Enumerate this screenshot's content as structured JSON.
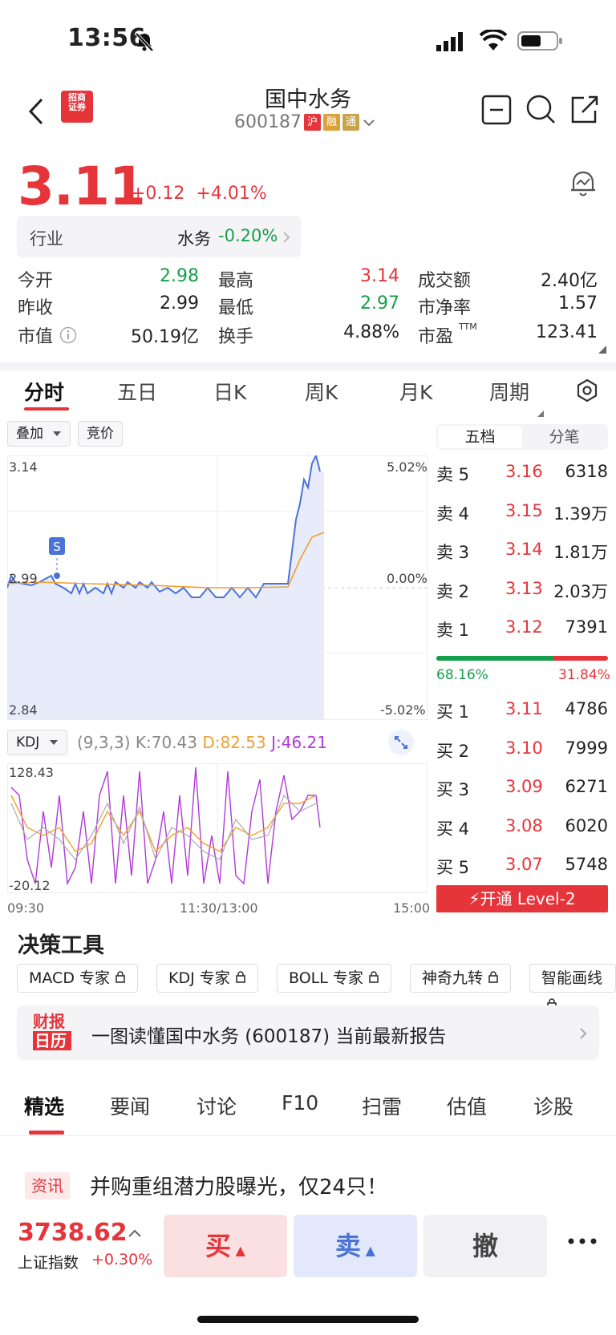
{
  "status": {
    "time": "13:56"
  },
  "header": {
    "title": "国中水务",
    "code": "600187",
    "badges": [
      "沪",
      "融",
      "通"
    ]
  },
  "quote": {
    "price": "3.11",
    "change": "+0.12",
    "change_pct": "+4.01%"
  },
  "industry": {
    "label": "行业",
    "name": "水务",
    "change": "-0.20%"
  },
  "stats": [
    {
      "label": "今开",
      "value": "2.98",
      "color": "green"
    },
    {
      "label": "最高",
      "value": "3.14",
      "color": "red"
    },
    {
      "label": "成交额",
      "value": "2.40亿",
      "color": ""
    },
    {
      "label": "昨收",
      "value": "2.99",
      "color": ""
    },
    {
      "label": "最低",
      "value": "2.97",
      "color": "green"
    },
    {
      "label": "市净率",
      "value": "1.57",
      "color": ""
    },
    {
      "label": "市值",
      "value": "50.19亿",
      "color": ""
    },
    {
      "label": "换手",
      "value": "4.88%",
      "color": ""
    },
    {
      "label": "市盈",
      "value": "123.41",
      "color": ""
    }
  ],
  "ttm": "TTM",
  "tabs": [
    "分时",
    "五日",
    "日K",
    "周K",
    "月K",
    "周期"
  ],
  "chips": {
    "overlay": "叠加",
    "auction": "竞价"
  },
  "chart": {
    "y_top": "3.14",
    "y_mid": "2.99",
    "y_bot": "2.84",
    "pct_top": "5.02%",
    "pct_mid": "0.00%",
    "pct_bot": "-5.02%",
    "marker": "S",
    "times": [
      "09:30",
      "11:30/13:00",
      "15:00"
    ]
  },
  "kdj": {
    "label": "KDJ",
    "params": "(9,3,3)",
    "k": "K:70.43",
    "d": "D:82.53",
    "j": "J:46.21",
    "top": "128.43",
    "bot": "-20.12"
  },
  "orderbook": {
    "tabs": [
      "五档",
      "分笔"
    ],
    "asks": [
      {
        "label": "卖 5",
        "price": "3.16",
        "vol": "6318"
      },
      {
        "label": "卖 4",
        "price": "3.15",
        "vol": "1.39万"
      },
      {
        "label": "卖 3",
        "price": "3.14",
        "vol": "1.81万"
      },
      {
        "label": "卖 2",
        "price": "3.13",
        "vol": "2.03万"
      },
      {
        "label": "卖 1",
        "price": "3.12",
        "vol": "7391"
      }
    ],
    "ratio_buy": "68.16%",
    "ratio_sell": "31.84%",
    "ratio_buy_value": 68.16,
    "bids": [
      {
        "label": "买 1",
        "price": "3.11",
        "vol": "4786"
      },
      {
        "label": "买 2",
        "price": "3.10",
        "vol": "7999"
      },
      {
        "label": "买 3",
        "price": "3.09",
        "vol": "6271"
      },
      {
        "label": "买 4",
        "price": "3.08",
        "vol": "6020"
      },
      {
        "label": "买 5",
        "price": "3.07",
        "vol": "5748"
      }
    ],
    "level2": "开通 Level-2"
  },
  "tools": {
    "title": "决策工具",
    "items": [
      "MACD 专家",
      "KDJ 专家",
      "BOLL 专家",
      "神奇九转",
      "智能画线"
    ]
  },
  "report": {
    "logo_top": "财报",
    "logo_bot": "日历",
    "text": "一图读懂国中水务 (600187) 当前最新报告"
  },
  "news_tabs": [
    "精选",
    "要闻",
    "讨论",
    "F10",
    "扫雷",
    "估值",
    "诊股"
  ],
  "news": {
    "tag": "资讯",
    "headline": "并购重组潜力股曝光，仅24只！"
  },
  "bottom": {
    "index_value": "3738.62",
    "index_name": "上证指数",
    "index_change": "+0.30%",
    "buy": "买",
    "sell": "卖",
    "cancel": "撤"
  }
}
